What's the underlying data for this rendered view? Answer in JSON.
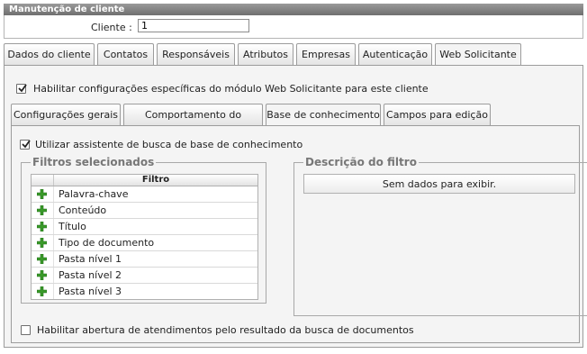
{
  "window": {
    "title": "Manutenção de cliente"
  },
  "client": {
    "label": "Cliente :",
    "value": "1"
  },
  "main_tabs": [
    {
      "label": "Dados do cliente"
    },
    {
      "label": "Contatos"
    },
    {
      "label": "Responsáveis"
    },
    {
      "label": "Atributos"
    },
    {
      "label": "Empresas"
    },
    {
      "label": "Autenticação"
    },
    {
      "label": "Web Solicitante"
    }
  ],
  "web_solicitante": {
    "enable_label": "Habilitar configurações específicas do módulo Web Solicitante para este cliente",
    "enable_checked": true,
    "sub_tabs": [
      {
        "label": "Configurações gerais"
      },
      {
        "label": "Comportamento do sistema"
      },
      {
        "label": "Base de conhecimento"
      },
      {
        "label": "Campos para edição"
      }
    ],
    "knowledge": {
      "assistant_label": "Utilizar assistente de busca de base de conhecimento",
      "assistant_checked": true,
      "filters_group": {
        "legend": "Filtros selecionados",
        "column_header": "Filtro",
        "rows": [
          "Palavra-chave",
          "Conteúdo",
          "Título",
          "Tipo de documento",
          "Pasta nível 1",
          "Pasta nível 2",
          "Pasta nível 3"
        ]
      },
      "description_group": {
        "legend": "Descrição do filtro",
        "empty_text": "Sem dados para exibir."
      },
      "open_tickets_label": "Habilitar abertura de atendimentos pelo resultado da busca de documentos",
      "open_tickets_checked": false
    }
  },
  "colors": {
    "plus_icon": "#3a9a2a",
    "title_bar": "#7f7f7f",
    "panel_bg": "#f4f4f4"
  }
}
